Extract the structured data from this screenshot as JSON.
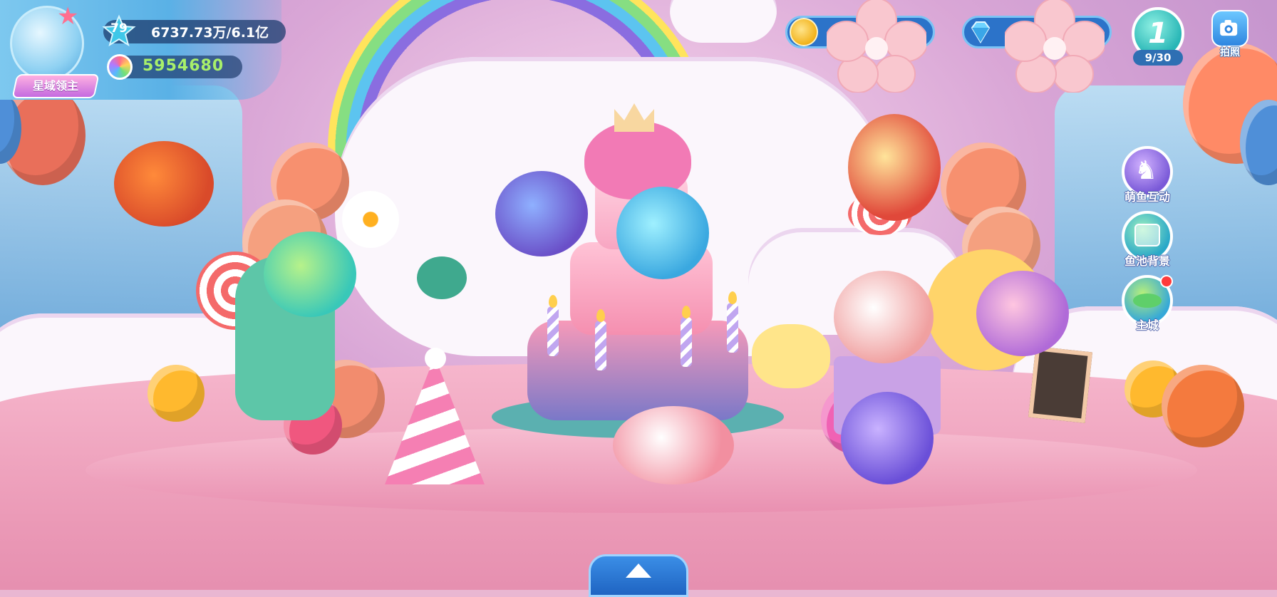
{
  "player": {
    "level": "79",
    "exp_text": "6737.73万/6.1亿",
    "currency_value": "5954680",
    "title": "星域领主",
    "icons": {
      "avatar": "mermaid-avatar-icon",
      "level": "star-level-icon",
      "currency": "rainbow-orb-icon"
    }
  },
  "resources": {
    "gold": {
      "icon": "gold-coin-icon",
      "value": ""
    },
    "gems": {
      "icon": "diamond-icon",
      "value": ""
    }
  },
  "quest": {
    "number": "1",
    "progress": "9/30"
  },
  "photo": {
    "label": "拍照",
    "icon": "camera-icon"
  },
  "side_menu": [
    {
      "label": "萌鱼互动",
      "icon": "seahorse-icon"
    },
    {
      "label": "鱼池背景",
      "icon": "aquarium-icon"
    },
    {
      "label": "主城",
      "icon": "island-icon",
      "has_notification": true
    }
  ],
  "bottom": {
    "expand_icon": "chevron-up-icon"
  },
  "colors": {
    "panel": "#5ab1e6",
    "title_badge": "#c46ae0",
    "currency_text": "#a8f06a",
    "notification": "#ff3b3b"
  }
}
